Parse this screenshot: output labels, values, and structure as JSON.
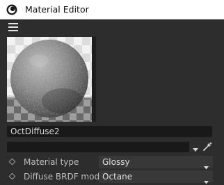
{
  "window": {
    "title": "Material Editor",
    "app_icon": "cinema4d-logo-icon"
  },
  "menubar": {
    "icon": "hamburger-menu-icon"
  },
  "preview": {
    "kind": "material-sphere-preview"
  },
  "material": {
    "name": "OctDiffuse2",
    "search_value": ""
  },
  "icons": {
    "search_arrow": "chevron-down-icon",
    "picker": "eyedropper-icon",
    "param_toggle": "diamond-keyframe-icon",
    "select_arrow": "chevron-down-icon"
  },
  "params": [
    {
      "label": "Material type",
      "value": "Glossy"
    },
    {
      "label": "Diffuse BRDF model",
      "value": "Octane"
    }
  ],
  "colors": {
    "panel_bg": "#2d2d2d",
    "field_bg": "#191919",
    "select_bg": "#383838",
    "titlebar_bg": "#ffffff"
  }
}
